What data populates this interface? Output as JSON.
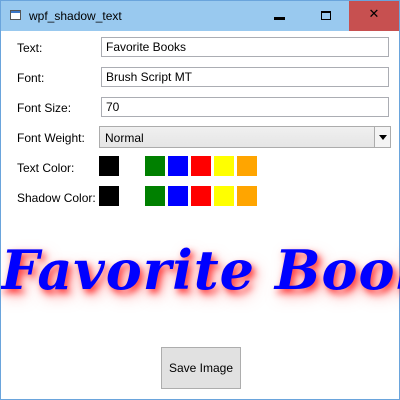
{
  "window": {
    "title": "wpf_shadow_text",
    "minimize_label": "",
    "maximize_label": "",
    "close_label": "✕"
  },
  "form": {
    "text_label": "Text:",
    "text_value": "Favorite Books",
    "font_label": "Font:",
    "font_value": "Brush Script MT",
    "font_size_label": "Font Size:",
    "font_size_value": "70",
    "font_weight_label": "Font Weight:",
    "font_weight_value": "Normal",
    "text_color_label": "Text Color:",
    "shadow_color_label": "Shadow Color:"
  },
  "palette": [
    {
      "name": "black",
      "color": "#000000"
    },
    {
      "name": "green",
      "color": "#008000"
    },
    {
      "name": "blue",
      "color": "#0000ff"
    },
    {
      "name": "red",
      "color": "#ff0000"
    },
    {
      "name": "yellow",
      "color": "#ffff00"
    },
    {
      "name": "orange",
      "color": "#ffa500"
    }
  ],
  "preview": {
    "text": "Favorite Books",
    "text_color": "#0000ff",
    "shadow_color": "#ff0000"
  },
  "save_button_label": "Save Image"
}
